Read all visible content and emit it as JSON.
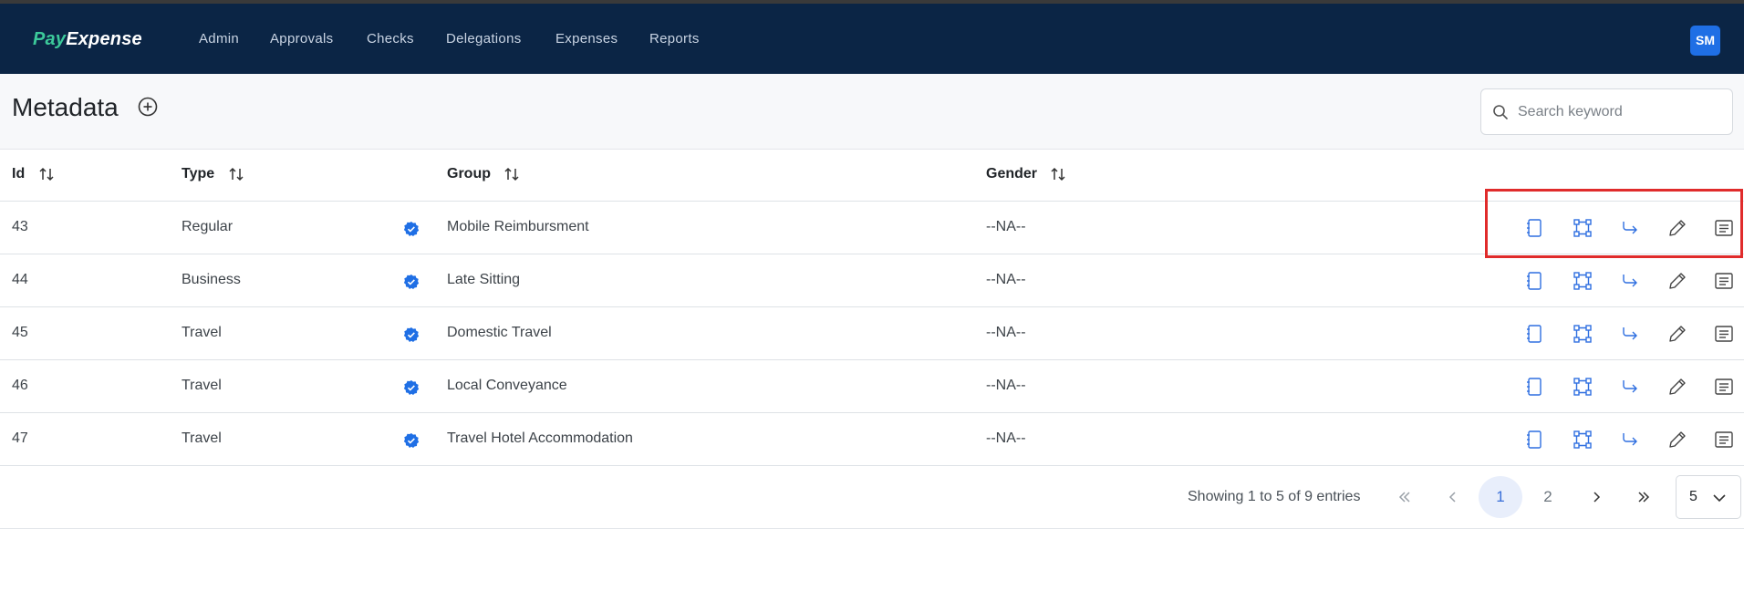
{
  "brand": {
    "logo_part1": "Pay",
    "logo_part2": "Expense"
  },
  "nav": {
    "items": [
      {
        "label": "Admin"
      },
      {
        "label": "Approvals"
      },
      {
        "label": "Checks"
      },
      {
        "label": "Delegations"
      },
      {
        "label": "Expenses"
      },
      {
        "label": "Reports"
      }
    ],
    "avatar_initials": "SM"
  },
  "page": {
    "title": "Metadata",
    "add_icon": "plus-circle-icon"
  },
  "search": {
    "placeholder": "Search keyword",
    "value": ""
  },
  "table": {
    "columns": [
      {
        "label": "Id"
      },
      {
        "label": "Type"
      },
      {
        "label": "Group"
      },
      {
        "label": "Gender"
      }
    ],
    "rows": [
      {
        "id": "43",
        "type": "Regular",
        "group": "Mobile Reimbursment",
        "gender": "--NA--"
      },
      {
        "id": "44",
        "type": "Business",
        "group": "Late Sitting",
        "gender": "--NA--"
      },
      {
        "id": "45",
        "type": "Travel",
        "group": "Domestic Travel",
        "gender": "--NA--"
      },
      {
        "id": "46",
        "type": "Travel",
        "group": "Local Conveyance",
        "gender": "--NA--"
      },
      {
        "id": "47",
        "type": "Travel",
        "group": "Travel Hotel Accommodation",
        "gender": "--NA--"
      }
    ],
    "row_actions": [
      "notebook-icon",
      "structure-icon",
      "forward-arrow-icon",
      "pencil-icon",
      "details-icon"
    ]
  },
  "pagination": {
    "summary": "Showing 1 to 5 of 9 entries",
    "pages": [
      "1",
      "2"
    ],
    "current_page": "1",
    "page_size": "5"
  },
  "colors": {
    "navbar": "#0b2545",
    "brand_green": "#3cc99a",
    "accent_blue": "#1f6fe5",
    "highlight_red": "#e02b2b"
  }
}
